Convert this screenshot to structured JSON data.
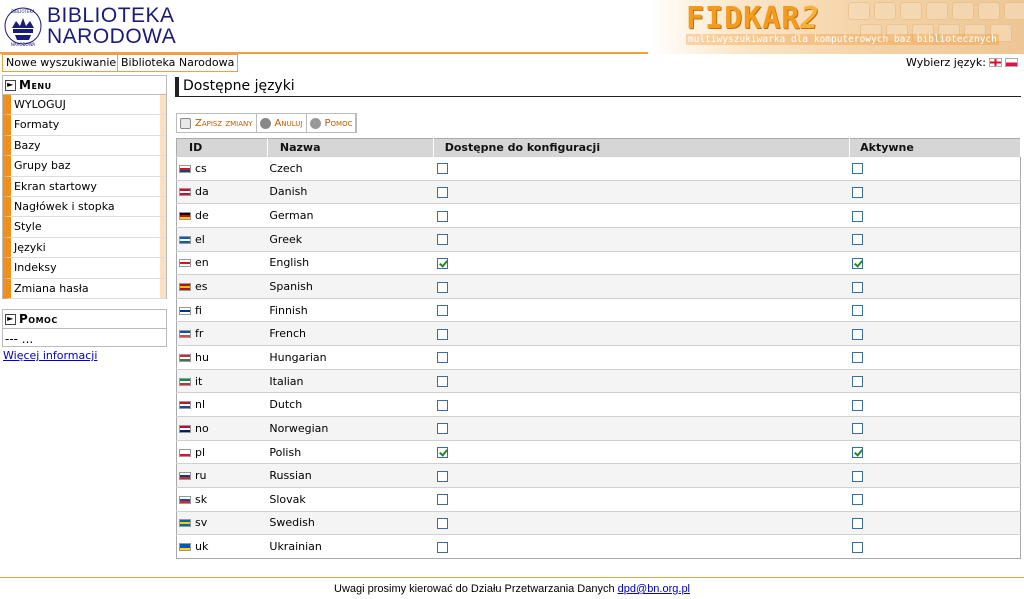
{
  "header": {
    "logo_emblem_text": "BIBLIOTEKA NARODOWA",
    "logo_line1": "BIBLIOTEKA",
    "logo_line2": "NARODOWA",
    "product_name": "FIDKAR",
    "product_version": "2",
    "product_tagline": "multiwyszukiwarka dla komputerowych baz bibliotecznych"
  },
  "topnav": {
    "new_search": "Nowe wyszukiwanie",
    "library": "Biblioteka Narodowa",
    "choose_language": "Wybierz język:"
  },
  "sidebar": {
    "menu_title": "Menu",
    "items": [
      {
        "label": "WYLOGUJ"
      },
      {
        "label": "Formaty"
      },
      {
        "label": "Bazy"
      },
      {
        "label": "Grupy baz"
      },
      {
        "label": "Ekran startowy"
      },
      {
        "label": "Nagłówek i stopka"
      },
      {
        "label": "Style"
      },
      {
        "label": "Języki"
      },
      {
        "label": "Indeksy"
      },
      {
        "label": "Zmiana hasła"
      }
    ],
    "help_title": "Pomoc",
    "help_text": "--- ...",
    "more_info": "Więcej informacji"
  },
  "main": {
    "title": "Dostępne języki",
    "toolbar": {
      "save": "Zapisz zmiany",
      "cancel": "Anuluj",
      "help": "Pomoc"
    },
    "table": {
      "headers": [
        "ID",
        "Nazwa",
        "Dostępne do konfiguracji",
        "Aktywne"
      ],
      "rows": [
        {
          "id": "cs",
          "name": "Czech",
          "available": false,
          "active": false,
          "flag": [
            "#ffffff",
            "#d7141a",
            "#11457e"
          ]
        },
        {
          "id": "da",
          "name": "Danish",
          "available": false,
          "active": false,
          "flag": [
            "#c8102e",
            "#ffffff",
            "#c8102e"
          ]
        },
        {
          "id": "de",
          "name": "German",
          "available": false,
          "active": false,
          "flag": [
            "#000000",
            "#dd0000",
            "#ffce00"
          ]
        },
        {
          "id": "el",
          "name": "Greek",
          "available": false,
          "active": false,
          "flag": [
            "#0d5eaf",
            "#ffffff",
            "#0d5eaf"
          ]
        },
        {
          "id": "en",
          "name": "English",
          "available": true,
          "active": true,
          "flag": [
            "#ffffff",
            "#cf142b",
            "#ffffff"
          ]
        },
        {
          "id": "es",
          "name": "Spanish",
          "available": false,
          "active": false,
          "flag": [
            "#aa151b",
            "#f1bf00",
            "#aa151b"
          ]
        },
        {
          "id": "fi",
          "name": "Finnish",
          "available": false,
          "active": false,
          "flag": [
            "#ffffff",
            "#003580",
            "#ffffff"
          ]
        },
        {
          "id": "fr",
          "name": "French",
          "available": false,
          "active": false,
          "flag": [
            "#0055a4",
            "#ffffff",
            "#ef4135"
          ]
        },
        {
          "id": "hu",
          "name": "Hungarian",
          "available": false,
          "active": false,
          "flag": [
            "#ce2939",
            "#ffffff",
            "#477050"
          ]
        },
        {
          "id": "it",
          "name": "Italian",
          "available": false,
          "active": false,
          "flag": [
            "#009246",
            "#ffffff",
            "#ce2b37"
          ]
        },
        {
          "id": "nl",
          "name": "Dutch",
          "available": false,
          "active": false,
          "flag": [
            "#ae1c28",
            "#ffffff",
            "#21468b"
          ]
        },
        {
          "id": "no",
          "name": "Norwegian",
          "available": false,
          "active": false,
          "flag": [
            "#ba0c2f",
            "#ffffff",
            "#00205b"
          ]
        },
        {
          "id": "pl",
          "name": "Polish",
          "available": true,
          "active": true,
          "flag": [
            "#ffffff",
            "#ffffff",
            "#dc143c"
          ]
        },
        {
          "id": "ru",
          "name": "Russian",
          "available": false,
          "active": false,
          "flag": [
            "#ffffff",
            "#0039a6",
            "#d52b1e"
          ]
        },
        {
          "id": "sk",
          "name": "Slovak",
          "available": false,
          "active": false,
          "flag": [
            "#ffffff",
            "#0b4ea2",
            "#ee1c25"
          ]
        },
        {
          "id": "sv",
          "name": "Swedish",
          "available": false,
          "active": false,
          "flag": [
            "#006aa7",
            "#fecc00",
            "#006aa7"
          ]
        },
        {
          "id": "uk",
          "name": "Ukrainian",
          "available": false,
          "active": false,
          "flag": [
            "#0057b7",
            "#0057b7",
            "#ffd700"
          ]
        }
      ]
    }
  },
  "footer": {
    "text": "Uwagi prosimy kierować do Działu Przetwarzania Danych",
    "email": "dpd@bn.org.pl"
  },
  "colors": {
    "accent": "#f08f1c",
    "header_border": "#f0a040",
    "table_header": "#d6d6d6",
    "link": "#0000cc"
  }
}
